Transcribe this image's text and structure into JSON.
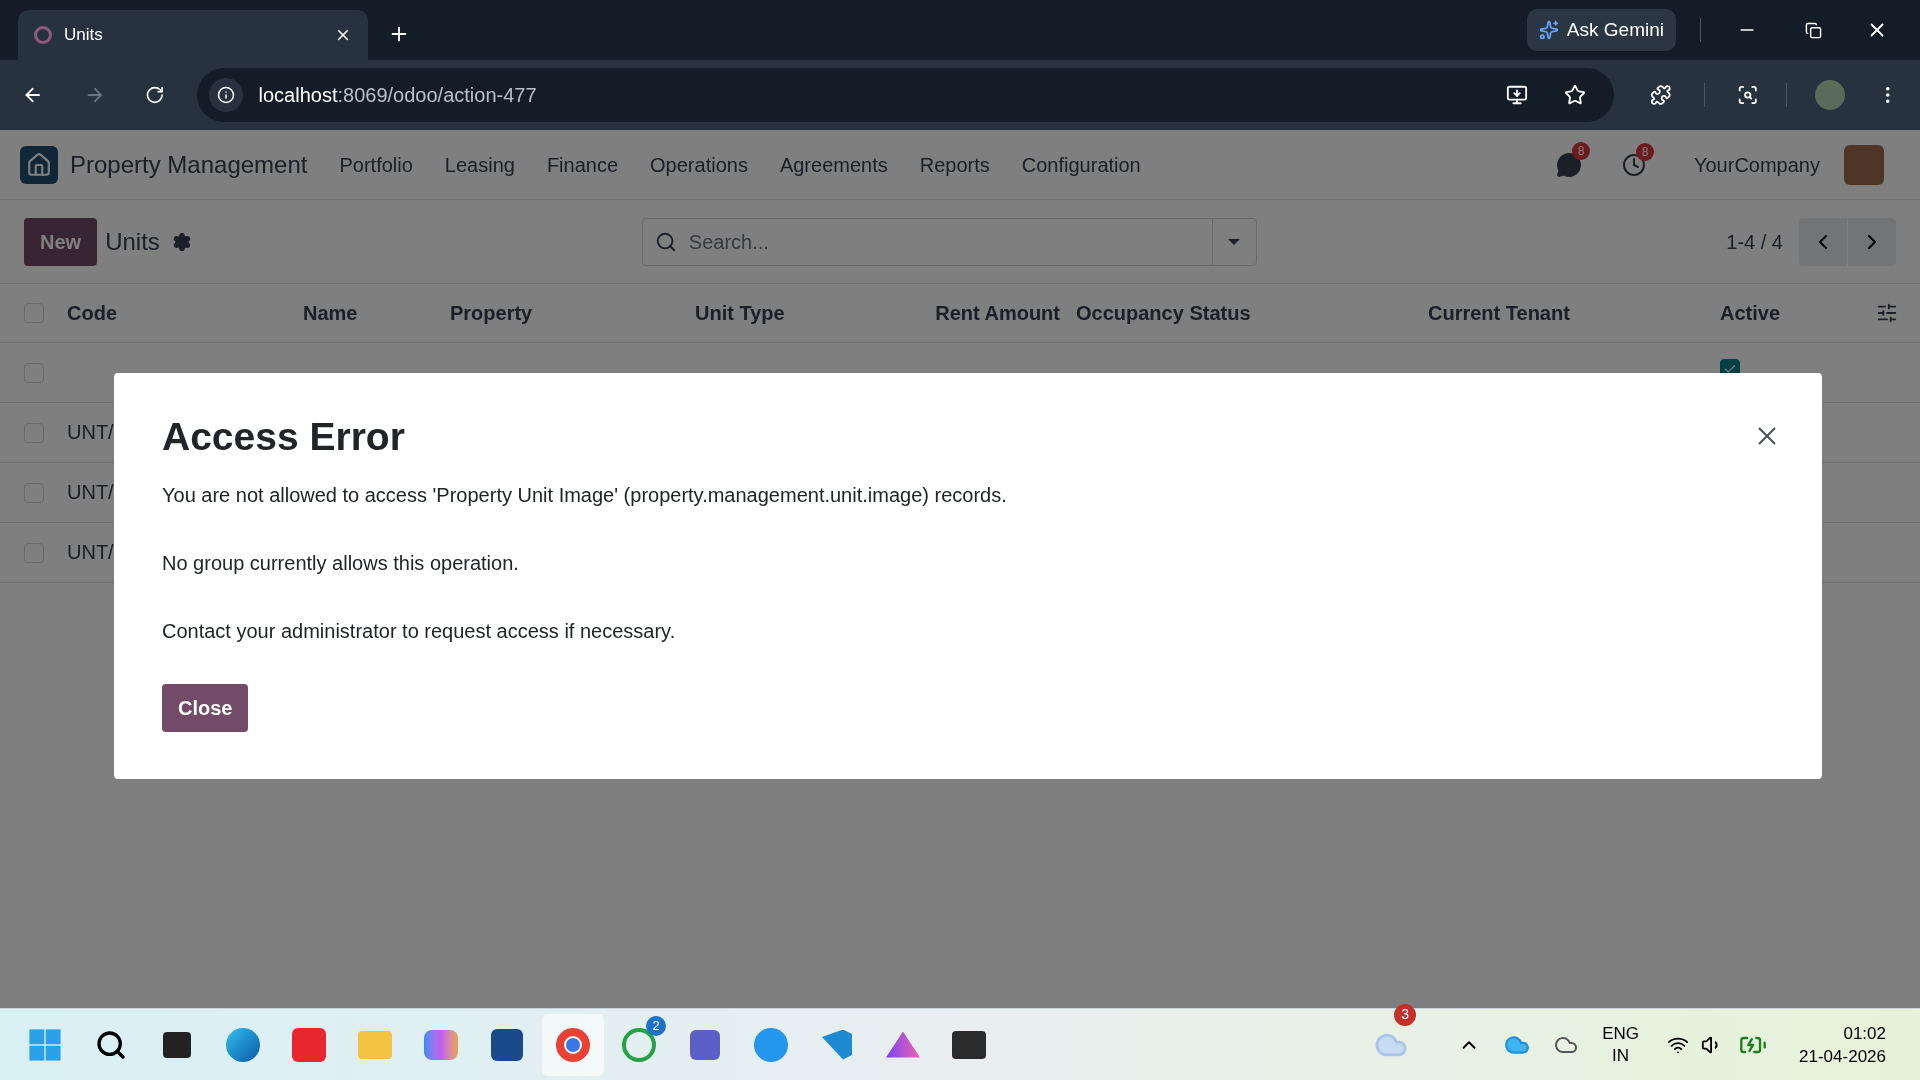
{
  "browser": {
    "tab_title": "Units",
    "address_host": "localhost",
    "address_path": ":8069/odoo/action-477",
    "ask_gemini": "Ask Gemini"
  },
  "navbar": {
    "brand": "Property Management",
    "menu": [
      "Portfolio",
      "Leasing",
      "Finance",
      "Operations",
      "Agreements",
      "Reports",
      "Configuration"
    ],
    "messages_count": "8",
    "activities_count": "8",
    "company": "YourCompany"
  },
  "control_panel": {
    "new_button": "New",
    "title": "Units",
    "search": {
      "placeholder": "Search..."
    },
    "pager": "1-4 / 4"
  },
  "table": {
    "select_all": {
      "checked": false
    },
    "columns": [
      "Code",
      "Name",
      "Property",
      "Unit Type",
      "Rent Amount",
      "Occupancy Status",
      "Current Tenant",
      "Active"
    ],
    "rows": [
      {
        "selected": false,
        "active": true
      },
      {
        "selected": false,
        "cells": [
          "UNT/"
        ]
      },
      {
        "selected": false,
        "cells": [
          "UNT/"
        ]
      },
      {
        "selected": false,
        "cells": [
          "UNT/"
        ]
      }
    ]
  },
  "dialog": {
    "title": "Access Error",
    "paragraphs": [
      "You are not allowed to access 'Property Unit Image' (property.management.unit.image) records.",
      "No group currently allows this operation.",
      "Contact your administrator to request access if necessary."
    ],
    "close_button": "Close"
  },
  "taskbar": {
    "whatsapp_badge": "2",
    "weather_badge": "3",
    "language": [
      "ENG",
      "IN"
    ],
    "time": "01:02",
    "date": "21-04-2026"
  }
}
